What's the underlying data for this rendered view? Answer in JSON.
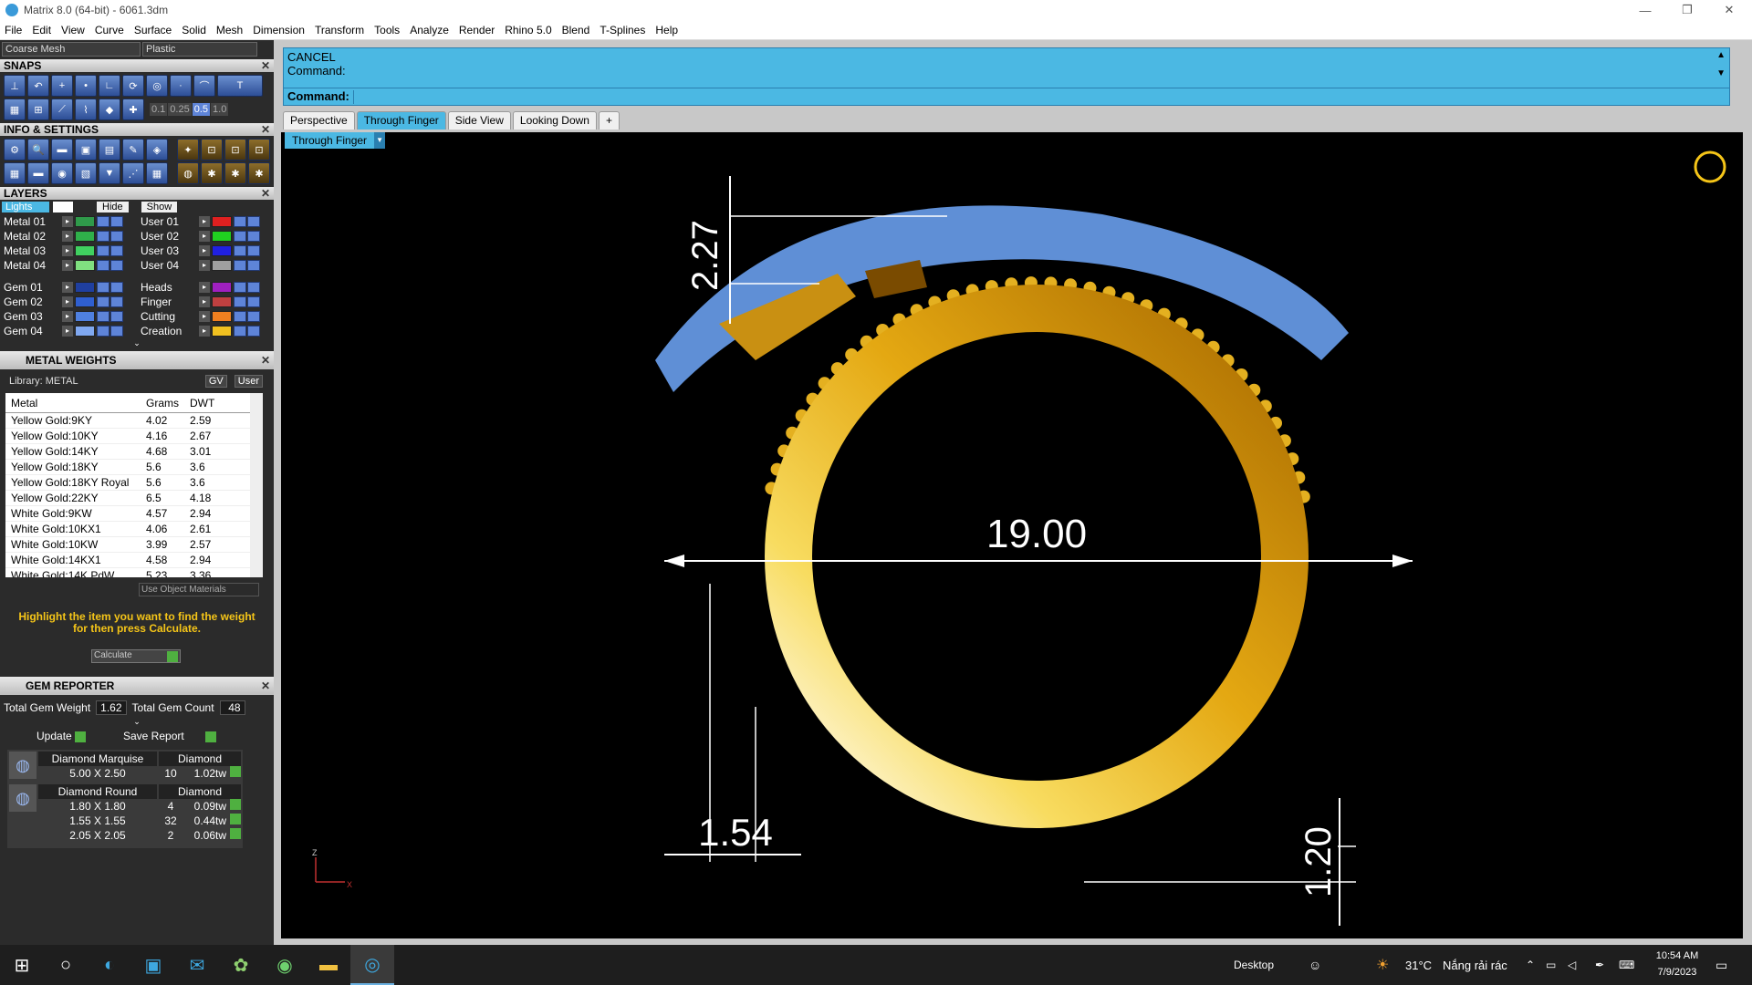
{
  "window": {
    "title": "Matrix 8.0 (64-bit) - 6061.3dm"
  },
  "menu": [
    "File",
    "Edit",
    "View",
    "Curve",
    "Surface",
    "Solid",
    "Mesh",
    "Dimension",
    "Transform",
    "Tools",
    "Analyze",
    "Render",
    "Rhino 5.0",
    "Blend",
    "T-Splines",
    "Help"
  ],
  "left": {
    "mesh_combo": "Coarse Mesh",
    "mat_combo": "Plastic",
    "snaps_title": "SNAPS",
    "snap_vals": [
      "0.1",
      "0.25",
      "0.5",
      "1.0"
    ],
    "info_title": "INFO & SETTINGS",
    "layers_title": "LAYERS",
    "lights_label": "Lights",
    "hide_label": "Hide",
    "show_label": "Show",
    "layers_left": [
      {
        "name": "Metal 01",
        "color": "#2f9a4a"
      },
      {
        "name": "Metal 02",
        "color": "#2fb04a"
      },
      {
        "name": "Metal 03",
        "color": "#40d060"
      },
      {
        "name": "Metal 04",
        "color": "#80e080"
      },
      {
        "name": "Gem 01",
        "color": "#1f3fa0"
      },
      {
        "name": "Gem 02",
        "color": "#2f5fd0"
      },
      {
        "name": "Gem 03",
        "color": "#4f80e0"
      },
      {
        "name": "Gem 04",
        "color": "#80a8f0"
      }
    ],
    "layers_right": [
      {
        "name": "User 01",
        "color": "#e02020"
      },
      {
        "name": "User 02",
        "color": "#20d020"
      },
      {
        "name": "User 03",
        "color": "#2020e0"
      },
      {
        "name": "User 04",
        "color": "#a0a0a0"
      },
      {
        "name": "Heads",
        "color": "#a020c0"
      },
      {
        "name": "Finger",
        "color": "#c04040"
      },
      {
        "name": "Cutting",
        "color": "#f08020"
      },
      {
        "name": "Creation",
        "color": "#f0c020"
      }
    ],
    "mw_title": "METAL WEIGHTS",
    "library": "Library: METAL",
    "gv": "GV",
    "user": "User",
    "headers": [
      "Metal",
      "Grams",
      "DWT"
    ],
    "metals": [
      {
        "name": "Yellow Gold:9KY",
        "g": "4.02",
        "d": "2.59"
      },
      {
        "name": "Yellow Gold:10KY",
        "g": "4.16",
        "d": "2.67"
      },
      {
        "name": "Yellow Gold:14KY",
        "g": "4.68",
        "d": "3.01"
      },
      {
        "name": "Yellow Gold:18KY",
        "g": "5.6",
        "d": "3.6"
      },
      {
        "name": "Yellow Gold:18KY Royal",
        "g": "5.6",
        "d": "3.6"
      },
      {
        "name": "Yellow Gold:22KY",
        "g": "6.5",
        "d": "4.18"
      },
      {
        "name": "White Gold:9KW",
        "g": "4.57",
        "d": "2.94"
      },
      {
        "name": "White Gold:10KX1",
        "g": "4.06",
        "d": "2.61"
      },
      {
        "name": "White Gold:10KW",
        "g": "3.99",
        "d": "2.57"
      },
      {
        "name": "White Gold:14KX1",
        "g": "4.58",
        "d": "2.94"
      },
      {
        "name": "White Gold:14K PdW",
        "g": "5.23",
        "d": "3.36"
      }
    ],
    "use_obj": "Use Object Materials",
    "hint": "Highlight the item you want to find the weight for then press Calculate.",
    "calculate": "Calculate",
    "gem_title": "GEM REPORTER",
    "tgw_label": "Total Gem Weight",
    "tgw": "1.62",
    "tgc_label": "Total Gem Count",
    "tgc": "48",
    "update": "Update",
    "save_report": "Save Report",
    "gems": [
      {
        "shape": "Diamond Marquise",
        "type": "Diamond",
        "rows": [
          {
            "size": "5.00 X 2.50",
            "n": "10",
            "w": "1.02tw"
          }
        ]
      },
      {
        "shape": "Diamond Round",
        "type": "Diamond",
        "rows": [
          {
            "size": "1.80 X 1.80",
            "n": "4",
            "w": "0.09tw"
          },
          {
            "size": "1.55 X 1.55",
            "n": "32",
            "w": "0.44tw"
          },
          {
            "size": "2.05 X 2.05",
            "n": "2",
            "w": "0.06tw"
          }
        ]
      }
    ]
  },
  "cmd": {
    "line1": "CANCEL",
    "line2": "Command:",
    "prompt": "Command:"
  },
  "tabs": [
    "Perspective",
    "Through Finger",
    "Side View",
    "Looking Down",
    "+"
  ],
  "viewport": {
    "label": "Through Finger",
    "dim_diam": "19.00",
    "dim_top": "2.27",
    "dim_left": "1.54",
    "dim_right": "1.20",
    "axis_z": "Z",
    "axis_x": "X"
  },
  "taskbar": {
    "desktop": "Desktop",
    "weather": "31°C",
    "weather_text": "Nắng rải rác",
    "time": "10:54 AM",
    "date": "7/9/2023"
  },
  "colors": {
    "accent": "#4bb8e3",
    "gold": "#e8b320",
    "dark_panel": "#2b2b2b"
  }
}
